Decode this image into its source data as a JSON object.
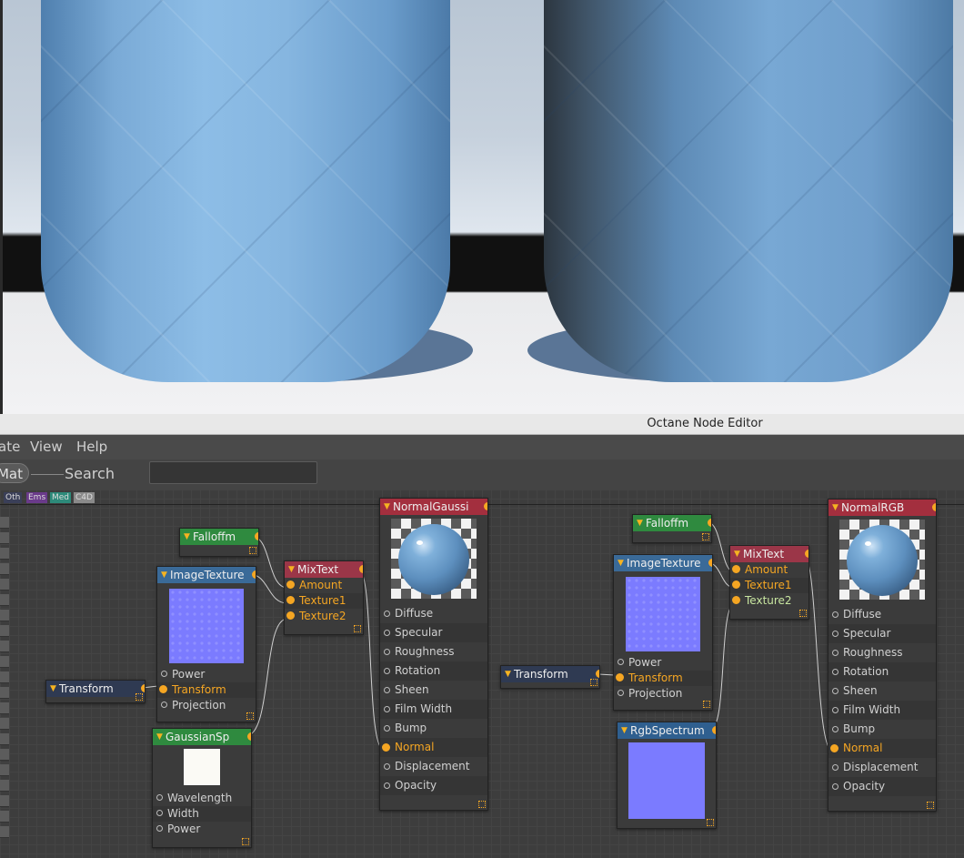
{
  "window": {
    "title": "Octane Node Editor"
  },
  "menubar": {
    "items": [
      "ate",
      "View",
      "Help"
    ]
  },
  "searchbar": {
    "mat_label": "Mat",
    "search_label": "Search",
    "search_value": ""
  },
  "tags": [
    "Oth",
    "Ems",
    "Med",
    "C4D"
  ],
  "colors": {
    "port": "#f5a623",
    "texture_preview": "#7b7bff",
    "white_preview": "#fbfaf5"
  },
  "nodes": {
    "falloff1": {
      "title": "Falloffm"
    },
    "imagetex1": {
      "title": "ImageTexture",
      "pins": [
        "Power",
        "Transform",
        "Projection"
      ]
    },
    "mixtex1": {
      "title": "MixText",
      "pins": [
        "Amount",
        "Texture1",
        "Texture2"
      ]
    },
    "transform1": {
      "title": "Transform"
    },
    "gaussian": {
      "title": "GaussianSp",
      "pins": [
        "Wavelength",
        "Width",
        "Power"
      ]
    },
    "normalgauss": {
      "title": "NormalGaussi",
      "pins": [
        "Diffuse",
        "Specular",
        "Roughness",
        "Rotation",
        "Sheen",
        "Film Width",
        "Bump",
        "Normal",
        "Displacement",
        "Opacity"
      ]
    },
    "falloff2": {
      "title": "Falloffm"
    },
    "imagetex2": {
      "title": "ImageTexture",
      "pins": [
        "Power",
        "Transform",
        "Projection"
      ]
    },
    "mixtex2": {
      "title": "MixText",
      "pins": [
        "Amount",
        "Texture1",
        "Texture2"
      ]
    },
    "transform2": {
      "title": "Transform"
    },
    "rgbspectrum": {
      "title": "RgbSpectrum"
    },
    "normalrgb": {
      "title": "NormalRGB",
      "pins": [
        "Diffuse",
        "Specular",
        "Roughness",
        "Rotation",
        "Sheen",
        "Film Width",
        "Bump",
        "Normal",
        "Displacement",
        "Opacity"
      ]
    }
  }
}
